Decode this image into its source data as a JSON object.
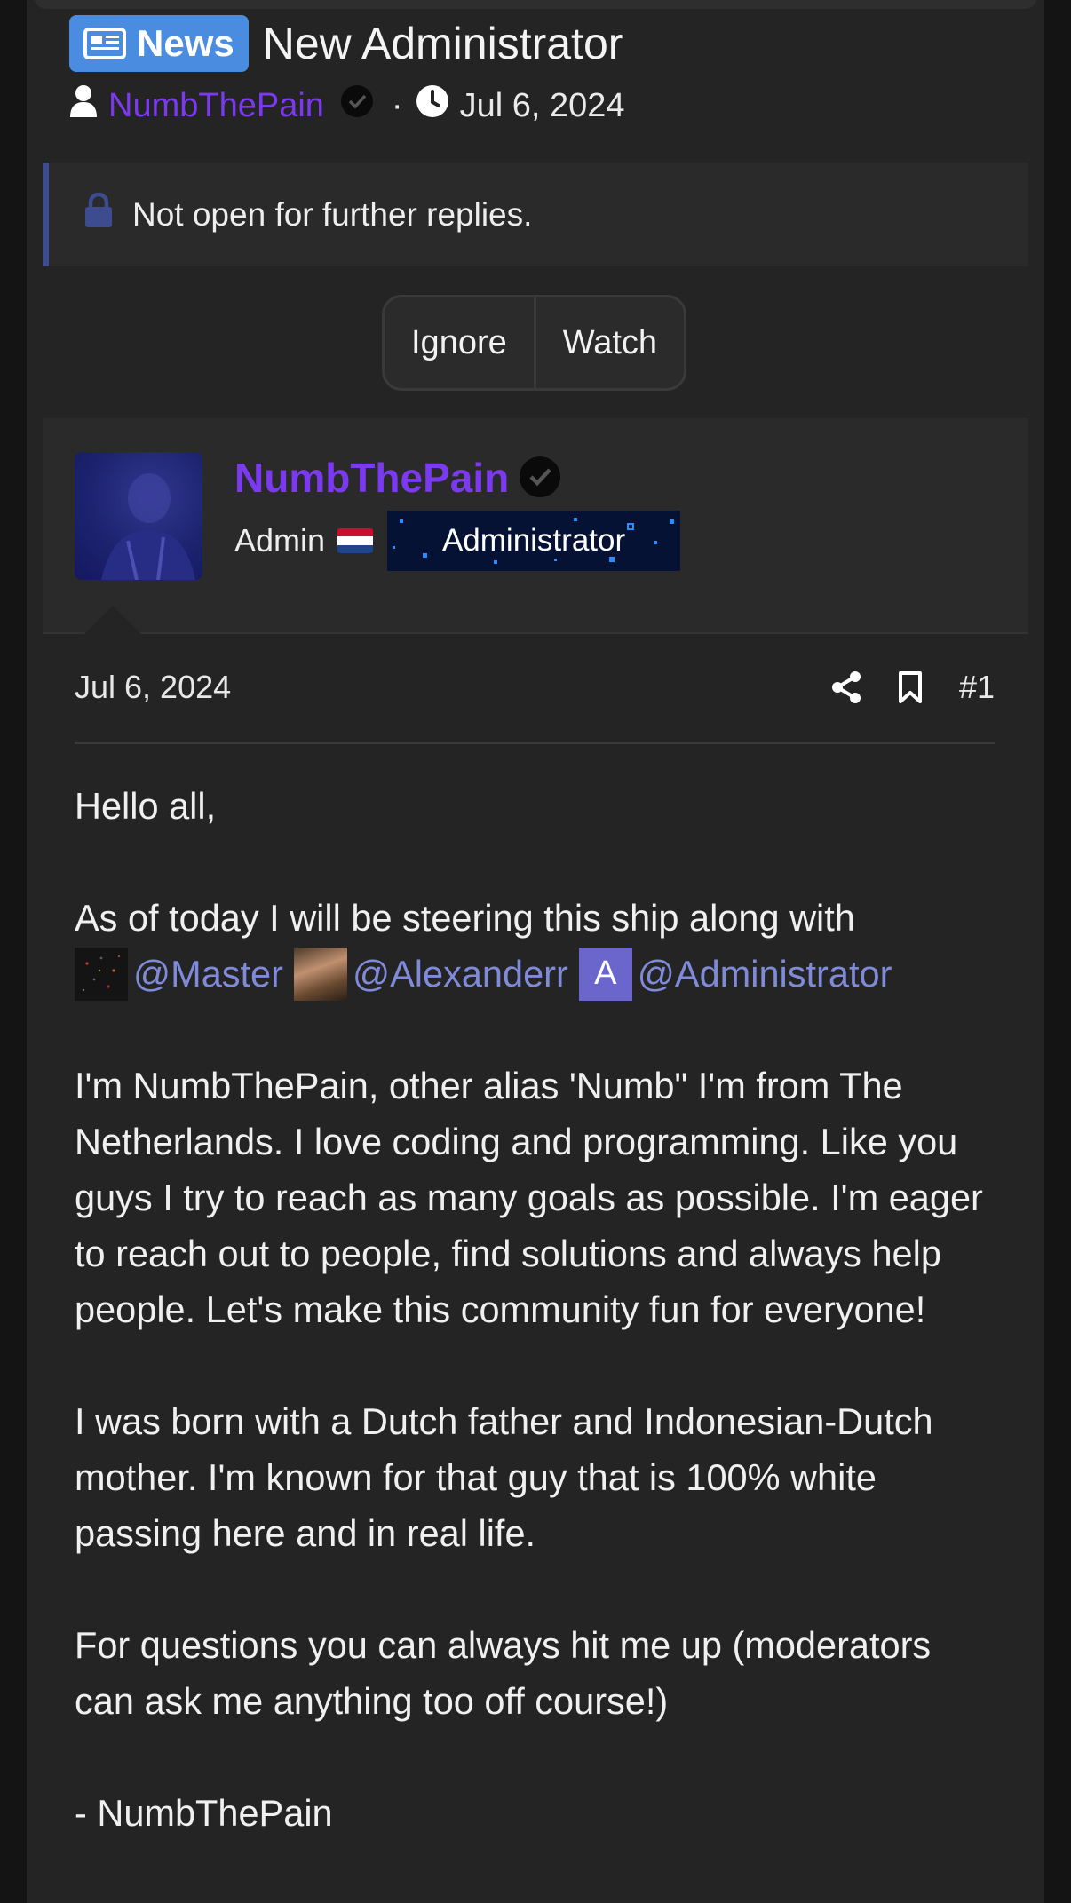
{
  "thread": {
    "prefix": "News",
    "title": "New Administrator",
    "author": "NumbThePain",
    "separator": "·",
    "date": "Jul 6, 2024"
  },
  "notice": {
    "text": "Not open for further replies."
  },
  "actions": {
    "ignore": "Ignore",
    "watch": "Watch"
  },
  "author_block": {
    "name": "NumbThePain",
    "title": "Admin",
    "banner": "Administrator"
  },
  "post": {
    "date": "Jul 6, 2024",
    "number": "#1",
    "greeting": "Hello all,",
    "intro": "As of today I will be steering this ship along with",
    "mentions": [
      "@Master",
      "@Alexanderr",
      "@Administrator"
    ],
    "admin_avatar_letter": "A",
    "para1": "I'm NumbThePain, other alias 'Numb\" I'm from The Netherlands. I love coding and programming. Like you guys I try to reach as many goals as possible. I'm eager to reach out to people, find solutions and always help people. Let's make this community fun for everyone!",
    "para2": "I was born with a Dutch father and Indonesian-Dutch mother. I'm known for that guy that is 100% white passing here and in real life.",
    "para3": "For questions you can always hit me up (moderators can ask me anything too off course!)",
    "signoff": "- NumbThePain"
  },
  "colors": {
    "background": "#242424",
    "username": "#7b3af0",
    "mention": "#7f8bd8",
    "prefix_badge": "#4a8ce0",
    "notice_accent": "#3d4b8f"
  },
  "icons": [
    "newspaper-icon",
    "user-icon",
    "verified-check-icon",
    "clock-icon",
    "lock-icon",
    "share-icon",
    "bookmark-icon"
  ]
}
